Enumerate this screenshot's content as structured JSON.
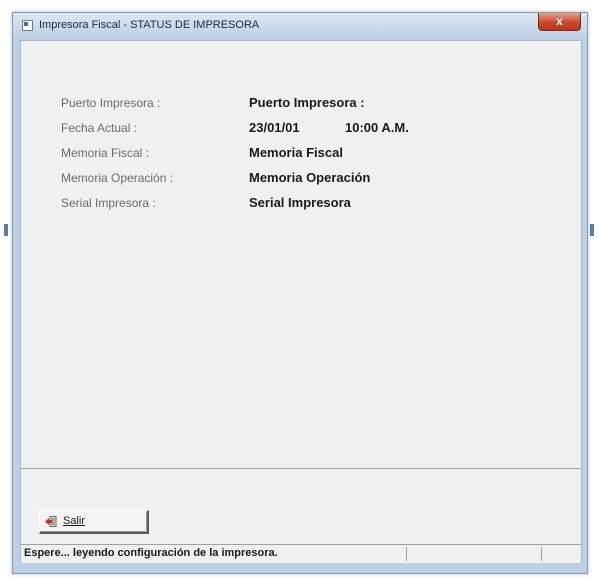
{
  "window": {
    "title": "Impresora Fiscal - STATUS DE IMPRESORA",
    "close_label": "x"
  },
  "status_info": {
    "rows": [
      {
        "label": "Puerto Impresora :",
        "value": "Puerto Impresora :"
      },
      {
        "label": "Fecha Actual :",
        "value": "23/01/01",
        "time": "10:00 A.M."
      },
      {
        "label": "Memoria Fiscal :",
        "value": "Memoria Fiscal"
      },
      {
        "label": "Memoria Operación :",
        "value": "Memoria Operación"
      },
      {
        "label": "Serial Impresora :",
        "value": "Serial Impresora"
      }
    ]
  },
  "exit_button": {
    "label": "Salir",
    "icon": "exit-door-icon"
  },
  "statusbar": {
    "text": "Espere... leyendo configuración de la impresora."
  },
  "colors": {
    "titlebar": "#bccde2",
    "close_button": "#c9482a",
    "client_background": "#f0f0f0"
  }
}
